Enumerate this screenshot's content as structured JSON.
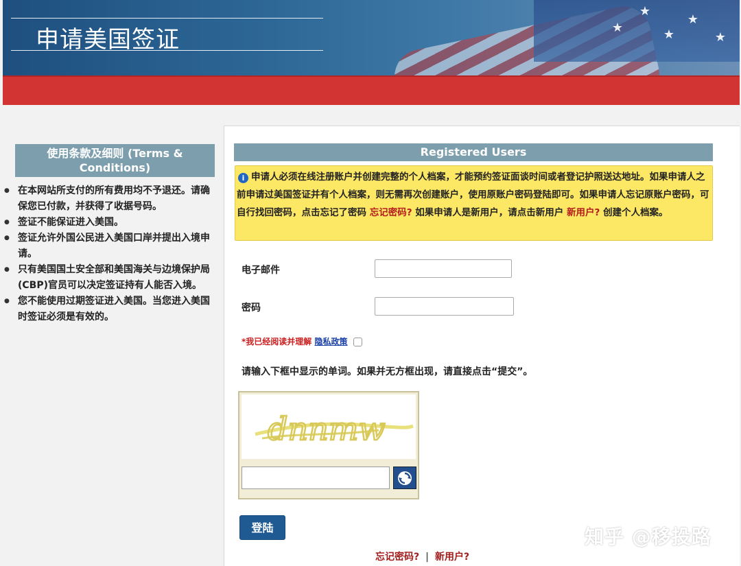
{
  "header": {
    "title": "申请美国签证"
  },
  "sidebar": {
    "terms_title": "使用条款及细则 (Terms & Conditions)",
    "items": [
      "在本网站所支付的所有费用均不予退还。请确保您已付款，并获得了收据号码。",
      "签证不能保证进入美国。",
      "签证允许外国公民进入美国口岸并提出入境申请。",
      "只有美国国土安全部和美国海关与边境保护局(CBP)官员可以决定签证持有人能否入境。",
      "您不能使用过期签证进入美国。当您进入美国时签证必须是有效的。"
    ]
  },
  "main": {
    "section_title": "Registered Users",
    "notice": {
      "icon": "info-icon",
      "text_1": "申请人必须在线注册账户并创建完整的个人档案，才能预约签证面谈时间或者登记护照送达地址。如果申请人之前申请过美国签证并有个人档案，则无需再次创建账户，使用原账户密码登陆即可。如果申请人忘记原账户密码，可自行找回密码，点击忘记了密码 ",
      "forgot_link": "忘记密码?",
      "text_2": " 如果申请人是新用户，请点击新用户 ",
      "new_user_link": "新用户?",
      "text_3": " 创建个人档案。"
    },
    "email_label": "电子邮件",
    "email_value": "",
    "password_label": "密码",
    "password_value": "",
    "agree": {
      "required_mark": "*",
      "text": "我已经阅读并理解",
      "link": "隐私政策",
      "checked": false
    },
    "captcha_instruction": "请输入下框中显示的单词。如果并无方框出现，请直接点击“提交”。",
    "captcha_word": "dnnmw",
    "captcha_input_value": "",
    "refresh_icon": "refresh-icon",
    "login_button": "登陆",
    "bottom_links": {
      "forgot": "忘记密码?",
      "separator": "|",
      "new_user": "新用户?"
    }
  },
  "watermark": "知乎 @移投路"
}
